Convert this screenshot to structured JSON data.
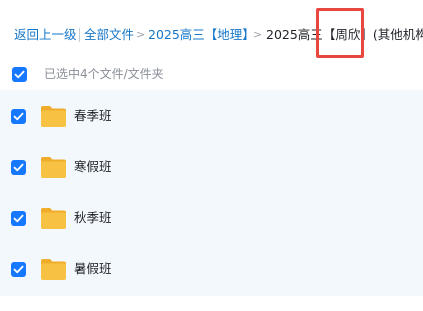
{
  "breadcrumb": {
    "back": "返回上一级",
    "all_files": "全部文件",
    "level1": "2025高三【地理】",
    "current_prefix": "2025高三",
    "current_highlight": "【周欣】",
    "current_suffix": "(其他机构..."
  },
  "selection": {
    "select_all_checked": true,
    "summary": "已选中4个文件/文件夹"
  },
  "files": [
    {
      "name": "春季班",
      "type": "folder",
      "checked": true
    },
    {
      "name": "寒假班",
      "type": "folder",
      "checked": true
    },
    {
      "name": "秋季班",
      "type": "folder",
      "checked": true
    },
    {
      "name": "暑假班",
      "type": "folder",
      "checked": true
    }
  ],
  "colors": {
    "link": "#1677c8",
    "checkbox": "#1677ff",
    "highlight_box": "#e8473f",
    "row_background": "#f3f8fd",
    "folder": "#f7c244"
  }
}
